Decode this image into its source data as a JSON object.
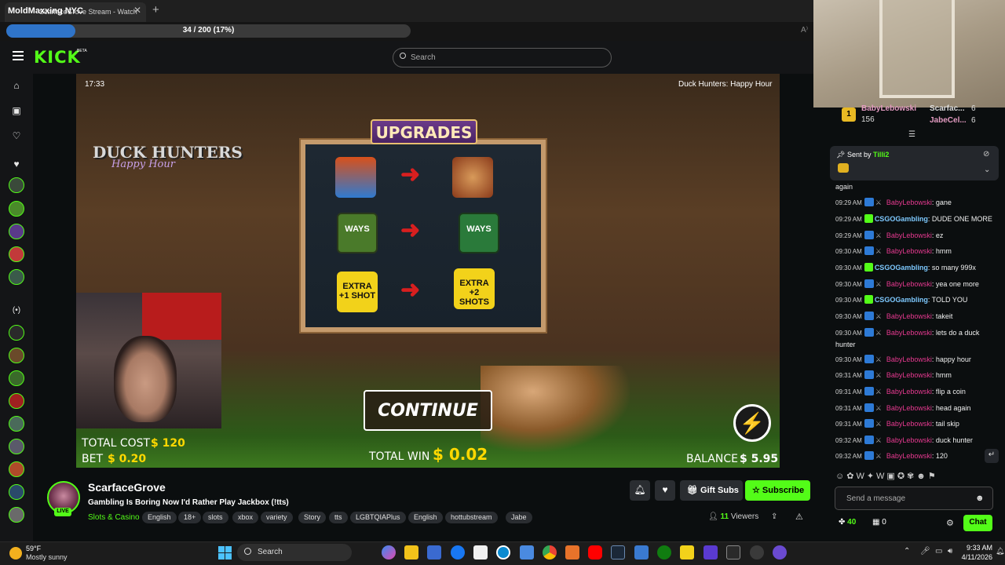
{
  "browser": {
    "overlay_title": "MoldMaxxing NYC",
    "tab_title": "ScarfaceGrove Stream - Watch",
    "tab_close": "✕",
    "new_tab": "+",
    "progress_text": "34 / 200 (17%)",
    "progress_fraction": 0.17
  },
  "kick": {
    "logo": "KICK",
    "beta": "BETA",
    "search_placeholder": "Search"
  },
  "video": {
    "timestamp": "17:33",
    "game_title": "Duck Hunters: Happy Hour",
    "logo_line1": "DUCK HUNTERS",
    "logo_line2": "Happy Hour",
    "upgrades_title": "UPGRADES",
    "tiles": {
      "ways": "WAYS",
      "infectious_ways": "WAYS",
      "extra1": "EXTRA +1 SHOT",
      "extra2": "EXTRA +2 SHOTS"
    },
    "continue": "CONTINUE",
    "total_cost_label": "TOTAL COST",
    "total_cost_value": "$ 120",
    "bet_label": "BET",
    "bet_value": "$ 0.20",
    "total_win_label": "TOTAL WIN",
    "total_win_value": "$ 0.02",
    "balance_label": "BALANCE",
    "balance_value": "$ 5.95"
  },
  "stream": {
    "channel_name": "ScarfaceGrove",
    "live": "LIVE",
    "title": "Gambling Is Boring Now I'd Rather Play Jackbox (!tts)",
    "category": "Slots & Casino",
    "tags": [
      "English",
      "18+",
      "slots",
      "xbox",
      "variety",
      "Story",
      "tts",
      "LGBTQIAPlus",
      "English",
      "hottubstream",
      "Jabe"
    ],
    "gift_subs": "Gift Subs",
    "subscribe": "Subscribe",
    "viewers_count": "11",
    "viewers_label": "Viewers"
  },
  "chat": {
    "leaderboard": [
      {
        "rank": "1",
        "name": "BabyLebowski",
        "count": "156"
      },
      {
        "name": "Scarfac...",
        "count": "6"
      },
      {
        "name": "JabeCel...",
        "count": "6"
      }
    ],
    "pinned_prefix": "Sent by",
    "pinned_user": "Tilli2",
    "again_text": "again",
    "messages": [
      {
        "time": "09:29 AM",
        "user": "BabyLebowski",
        "text": ": gane",
        "style": "pink"
      },
      {
        "time": "09:29 AM",
        "user": "CSGOGambling",
        "text": ": DUDE ONE MORE",
        "style": "green"
      },
      {
        "time": "09:29 AM",
        "user": "BabyLebowski",
        "text": ": ez",
        "style": "pink"
      },
      {
        "time": "09:30 AM",
        "user": "BabyLebowski",
        "text": ": hmm",
        "style": "pink"
      },
      {
        "time": "09:30 AM",
        "user": "CSGOGambling",
        "text": ": so many 999x",
        "style": "green"
      },
      {
        "time": "09:30 AM",
        "user": "BabyLebowski",
        "text": ": yea one more",
        "style": "pink"
      },
      {
        "time": "09:30 AM",
        "user": "CSGOGambling",
        "text": ": TOLD YOU",
        "style": "green"
      },
      {
        "time": "09:30 AM",
        "user": "BabyLebowski",
        "text": ": takeit",
        "style": "pink"
      },
      {
        "time": "09:30 AM",
        "user": "BabyLebowski",
        "text": ": lets do a duck hunter",
        "style": "pink"
      },
      {
        "time": "09:30 AM",
        "user": "BabyLebowski",
        "text": ": happy hour",
        "style": "pink"
      },
      {
        "time": "09:31 AM",
        "user": "BabyLebowski",
        "text": ": hmm",
        "style": "pink"
      },
      {
        "time": "09:31 AM",
        "user": "BabyLebowski",
        "text": ": flip a coin",
        "style": "pink"
      },
      {
        "time": "09:31 AM",
        "user": "BabyLebowski",
        "text": ": head again",
        "style": "pink"
      },
      {
        "time": "09:31 AM",
        "user": "BabyLebowski",
        "text": ": tail skip",
        "style": "pink"
      },
      {
        "time": "09:32 AM",
        "user": "BabyLebowski",
        "text": ": duck hunter",
        "style": "pink"
      },
      {
        "time": "09:32 AM",
        "user": "BabyLebowski",
        "text": ": 120",
        "style": "pink"
      }
    ],
    "input_placeholder": "Send a message",
    "points": "40",
    "drops": "0",
    "chat_button": "Chat"
  },
  "taskbar": {
    "temperature": "59°F",
    "weather": "Mostly sunny",
    "search": "Search",
    "time": "9:33 AM",
    "date": "4/11/2026"
  },
  "colors": {
    "kick_green": "#53fc18",
    "chat_user_pink": "#e5398f",
    "progress_blue": "#2f74c9"
  }
}
